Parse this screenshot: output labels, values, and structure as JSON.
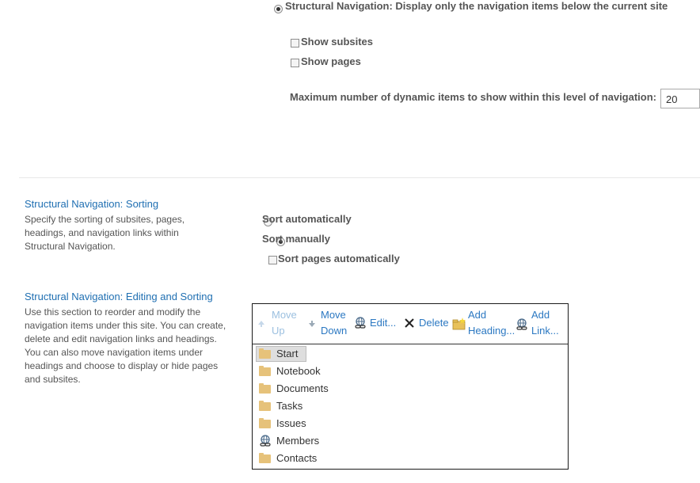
{
  "top_section": {
    "structural_option_label": "Structural Navigation: Display only the navigation items below the current site",
    "show_subsites_label": "Show subsites",
    "show_pages_label": "Show pages",
    "max_items_label": "Maximum number of dynamic items to show within this level of navigation:",
    "max_items_value": "20"
  },
  "sorting_section": {
    "title": "Structural Navigation: Sorting",
    "description": "Specify the sorting of subsites, pages, headings, and navigation links within Structural Navigation.",
    "sort_auto_label": "Sort automatically",
    "sort_manual_label": "Sort manually",
    "sort_pages_auto_label": "Sort pages automatically"
  },
  "editing_section": {
    "title": "Structural Navigation: Editing and Sorting",
    "description": "Use this section to reorder and modify the navigation items under this site. You can create, delete and edit navigation links and headings. You can also move navigation items under headings and choose to display or hide pages and subsites."
  },
  "toolbar": {
    "move_up_line1": "Move",
    "move_up_line2": "Up",
    "move_down_line1": "Move",
    "move_down_line2": "Down",
    "edit_label": "Edit...",
    "delete_label": "Delete",
    "add_heading_line1": "Add",
    "add_heading_line2": "Heading...",
    "add_link_line1": "Add",
    "add_link_line2": "Link..."
  },
  "tree": {
    "items": [
      {
        "label": "Start",
        "icon": "folder-icon"
      },
      {
        "label": "Notebook",
        "icon": "folder-icon"
      },
      {
        "label": "Documents",
        "icon": "folder-icon"
      },
      {
        "label": "Tasks",
        "icon": "folder-icon"
      },
      {
        "label": "Issues",
        "icon": "folder-icon"
      },
      {
        "label": "Members",
        "icon": "link-icon"
      },
      {
        "label": "Contacts",
        "icon": "folder-icon"
      }
    ]
  },
  "colors": {
    "section_title": "#1f6fb2",
    "folder": "#e6c27a",
    "toolbar_link": "#2b78c2"
  }
}
